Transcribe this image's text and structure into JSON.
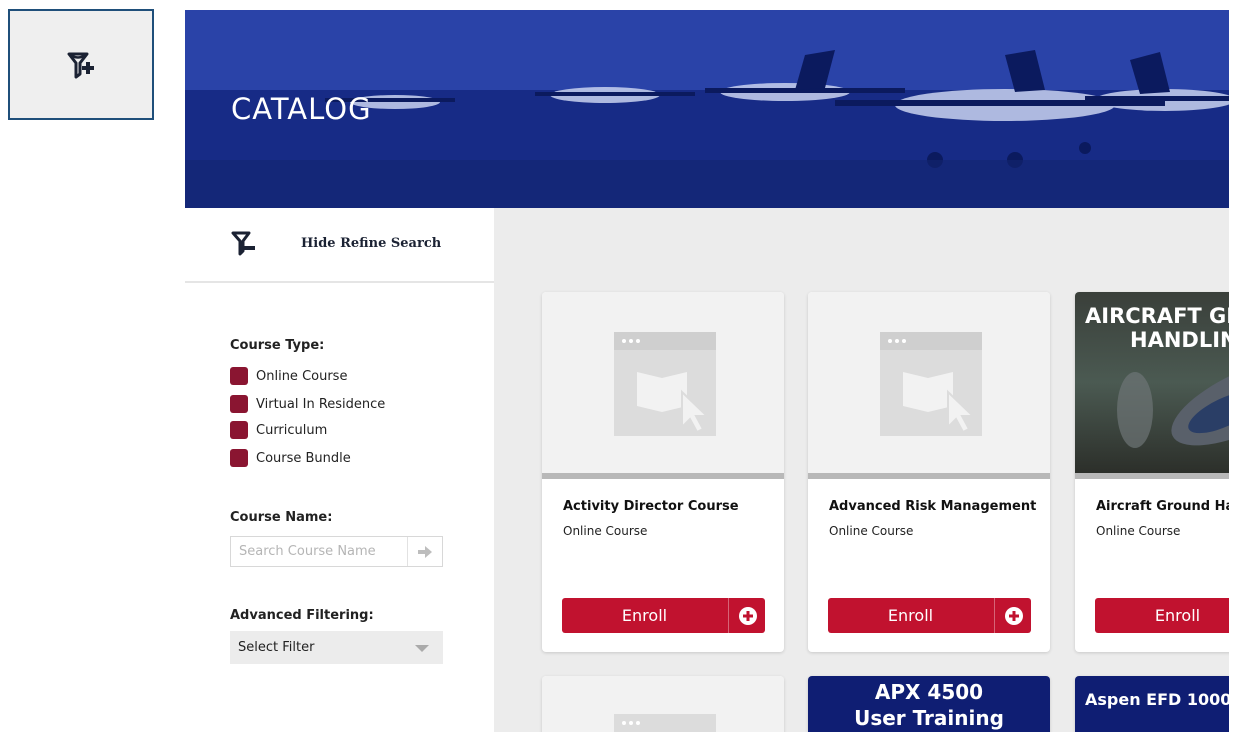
{
  "float_toggle": {
    "icon": "filter-plus-icon"
  },
  "banner": {
    "title": "CATALOG"
  },
  "sidebar": {
    "hide_refine_label": "Hide Refine Search",
    "course_type_label": "Course Type:",
    "course_types": [
      "Online Course",
      "Virtual In Residence",
      "Curriculum",
      "Course Bundle"
    ],
    "course_name_label": "Course Name:",
    "search_placeholder": "Search Course Name",
    "advanced_label": "Advanced Filtering:",
    "select_value": "Select Filter"
  },
  "colors": {
    "accent": "#c1122f",
    "swatch": "#8a1531",
    "banner": "#1a2f8a",
    "tile_navy": "#0f1e73"
  },
  "cards": [
    {
      "title": "Activity Director Course",
      "type": "Online Course",
      "enroll": "Enroll"
    },
    {
      "title": "Advanced Risk Management",
      "type": "Online Course",
      "enroll": "Enroll"
    },
    {
      "title": "Aircraft Ground Handling",
      "type": "Online Course",
      "enroll": "Enroll",
      "image_text_1": "AIRCRAFT GR",
      "image_text_2": "HANDLIN"
    }
  ],
  "row2": {
    "tile2_line1": "APX 4500",
    "tile2_line2": "User Training",
    "tile3": "Aspen EFD 1000"
  }
}
